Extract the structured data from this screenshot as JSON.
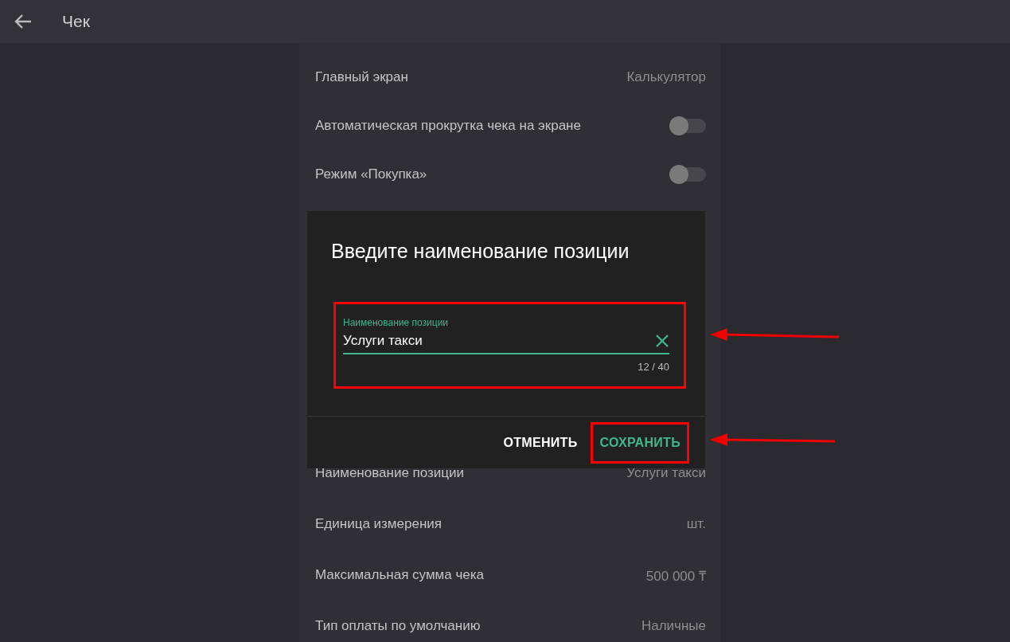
{
  "header": {
    "title": "Чек"
  },
  "settings": [
    {
      "kind": "value",
      "label": "Главный экран",
      "value": "Калькулятор"
    },
    {
      "kind": "toggle",
      "label": "Автоматическая прокрутка чека на экране",
      "on": false
    },
    {
      "kind": "toggle",
      "label": "Режим «Покупка»",
      "on": false
    },
    {
      "kind": "gap"
    },
    {
      "kind": "value",
      "label": "Наименование позиции",
      "value": "Услуги такси"
    },
    {
      "kind": "value",
      "label": "Единица измерения",
      "value": "шт."
    },
    {
      "kind": "value",
      "label": "Максимальная сумма чека",
      "value": "500 000 ₸"
    },
    {
      "kind": "value",
      "label": "Тип оплаты по умолчанию",
      "value": "Наличные"
    }
  ],
  "dialog": {
    "title": "Введите наименование позиции",
    "field": {
      "label": "Наименование позиции",
      "value": "Услуги такси",
      "counter": "12 / 40"
    },
    "buttons": [
      {
        "label": "ОТМЕНИТЬ",
        "primary": false
      },
      {
        "label": "СОХРАНИТЬ",
        "primary": true
      }
    ]
  }
}
